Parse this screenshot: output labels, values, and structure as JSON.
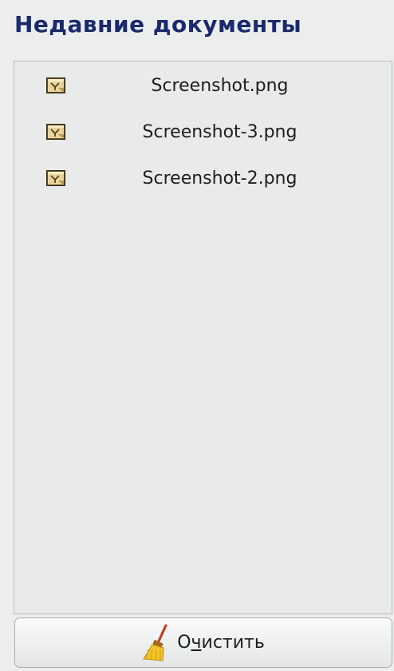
{
  "panel": {
    "title": "Недавние документы"
  },
  "recent_documents": [
    {
      "name": "Screenshot.png",
      "icon": "image-file-icon"
    },
    {
      "name": "Screenshot-3.png",
      "icon": "image-file-icon"
    },
    {
      "name": "Screenshot-2.png",
      "icon": "image-file-icon"
    }
  ],
  "clear_button": {
    "label_prefix": "О",
    "label_mnemonic": "ч",
    "label_rest": "истить",
    "icon": "broom-icon"
  },
  "colors": {
    "title": "#1a2a6c",
    "background": "#eceeee",
    "list_background": "#e9ebea"
  }
}
